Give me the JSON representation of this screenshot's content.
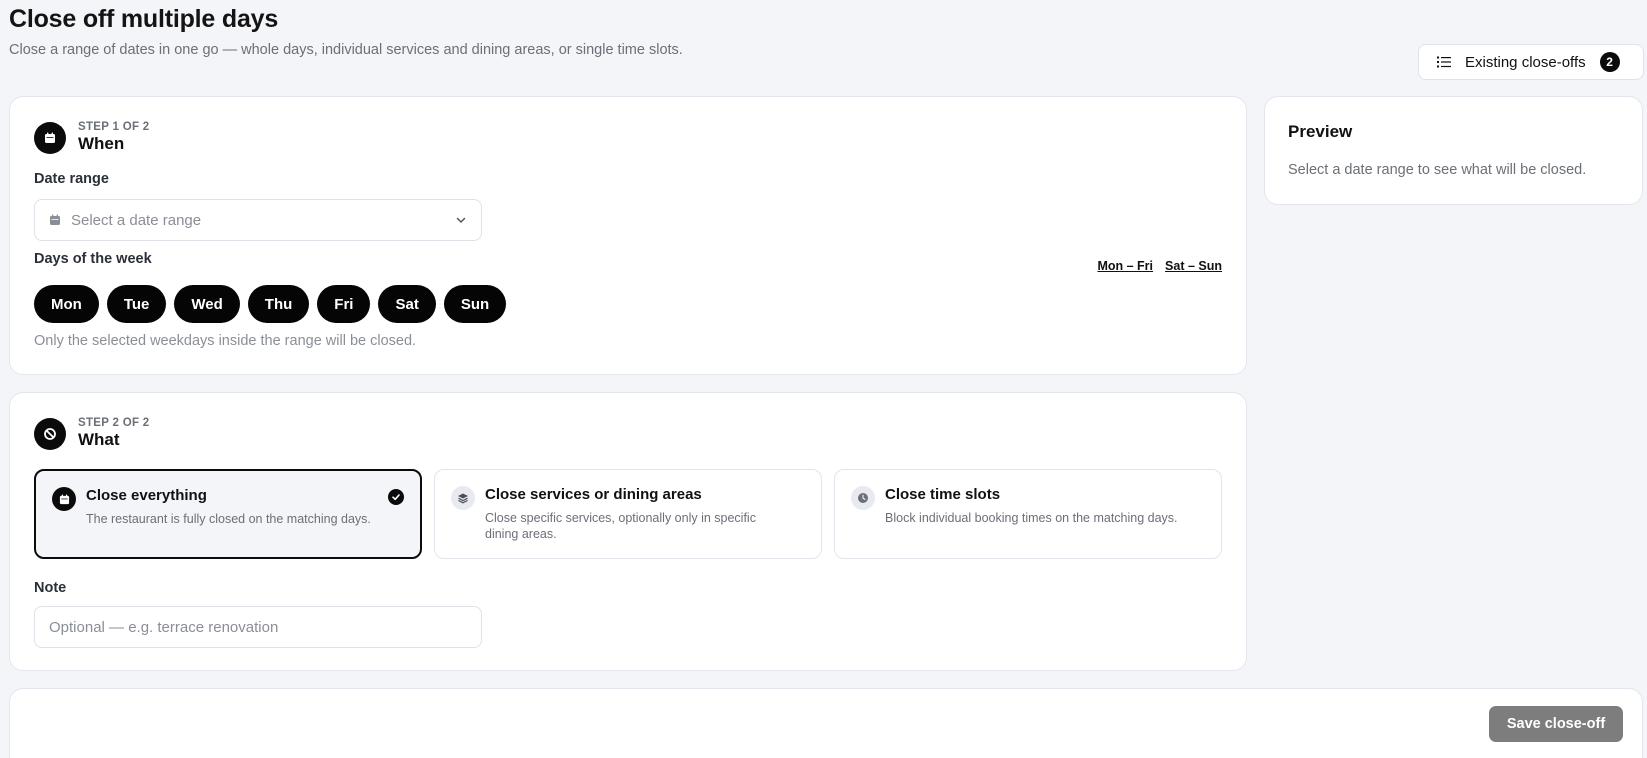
{
  "page": {
    "title": "Close off multiple days",
    "subtitle": "Close a range of dates in one go — whole days, individual services and dining areas, or single time slots."
  },
  "existing_button": {
    "label": "Existing close-offs",
    "count": "2"
  },
  "step1": {
    "kicker": "STEP 1 OF 2",
    "title": "When",
    "date_range_label": "Date range",
    "date_range_placeholder": "Select a date range",
    "days_label": "Days of the week",
    "quick_weekdays": "Mon – Fri",
    "quick_weekend": "Sat – Sun",
    "days": [
      "Mon",
      "Tue",
      "Wed",
      "Thu",
      "Fri",
      "Sat",
      "Sun"
    ],
    "days_hint": "Only the selected weekdays inside the range will be closed."
  },
  "step2": {
    "kicker": "STEP 2 OF 2",
    "title": "What",
    "options": [
      {
        "title": "Close everything",
        "desc": "The restaurant is fully closed on the matching days.",
        "selected": true
      },
      {
        "title": "Close services or dining areas",
        "desc": "Close specific services, optionally only in specific dining areas.",
        "selected": false
      },
      {
        "title": "Close time slots",
        "desc": "Block individual booking times on the matching days.",
        "selected": false
      }
    ],
    "note_label": "Note",
    "note_placeholder": "Optional — e.g. terrace renovation"
  },
  "preview": {
    "title": "Preview",
    "text": "Select a date range to see what will be closed."
  },
  "footer": {
    "save_label": "Save close-off"
  }
}
